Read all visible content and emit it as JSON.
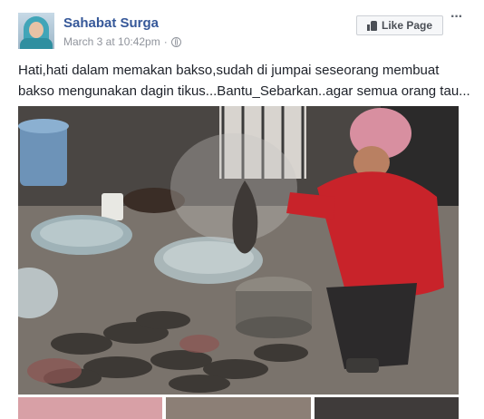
{
  "page": {
    "name": "Sahabat Surga",
    "date": "March 3 at 10:42pm",
    "separator": "·"
  },
  "actions": {
    "like_label": "Like Page",
    "more_label": "···"
  },
  "post": {
    "text_line1": "Hati,hati dalam memakan bakso,sudah di jumpai seseorang membuat",
    "text_line2": "bakso mengunakan dagin tikus...Bantu_Sebarkan..agar semua orang tau..."
  },
  "icons": {
    "avatar": "profile-avatar",
    "privacy": "globe-icon",
    "like": "thumbs-up-icon",
    "more": "more-options-icon"
  },
  "colors": {
    "link": "#365899",
    "meta": "#90949c",
    "button_bg": "#f6f7f9"
  }
}
